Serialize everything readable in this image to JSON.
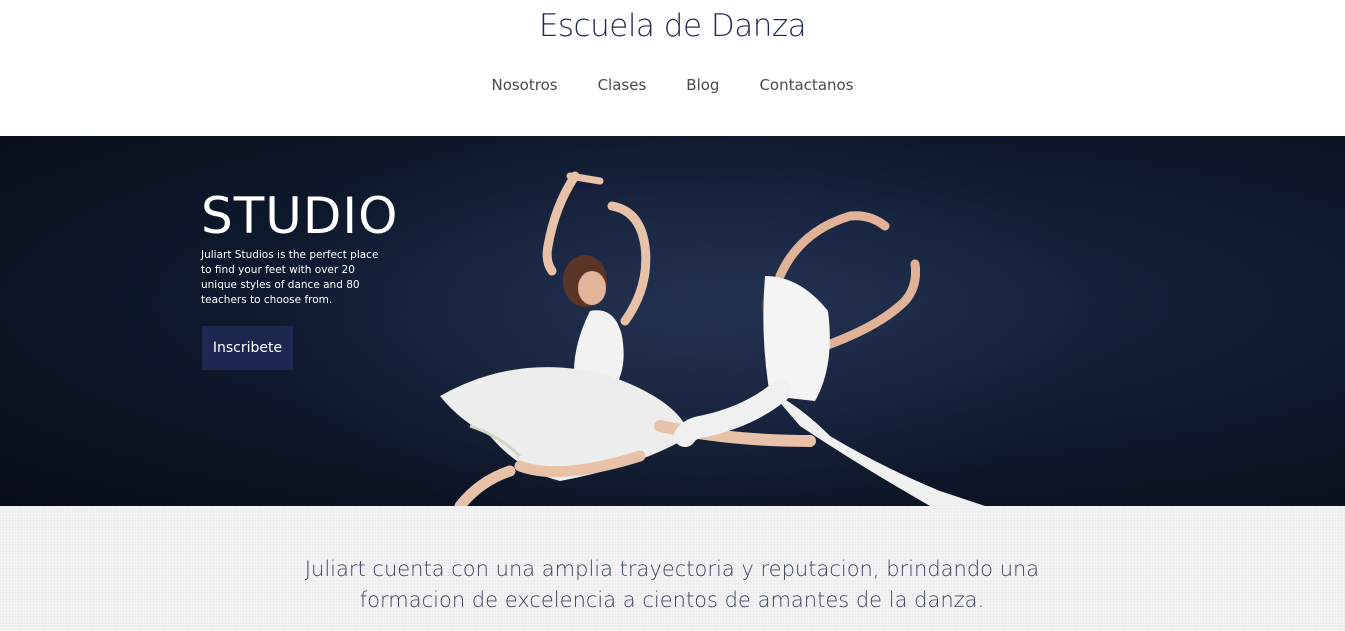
{
  "header": {
    "site_title": "Escuela de Danza",
    "nav": [
      {
        "label": "Nosotros"
      },
      {
        "label": "Clases"
      },
      {
        "label": "Blog"
      },
      {
        "label": "Contactanos"
      }
    ]
  },
  "hero": {
    "heading": "STUDIO",
    "description": "Juliart Studios is the perfect place to find your feet with over 20 unique styles of dance and 80 teachers to choose from.",
    "button_label": "Inscribete",
    "image_alt": "two-dancers-leaping-photo"
  },
  "about": {
    "text": "Juliart cuenta con una amplia trayectoria y reputacion, brindando una formacion de excelencia a cientos de amantes de la danza."
  },
  "colors": {
    "brand_navy": "#1c2850",
    "hero_background": "#0f1a30",
    "title_text": "#1f2b4d",
    "about_background": "#f0f0f0"
  }
}
